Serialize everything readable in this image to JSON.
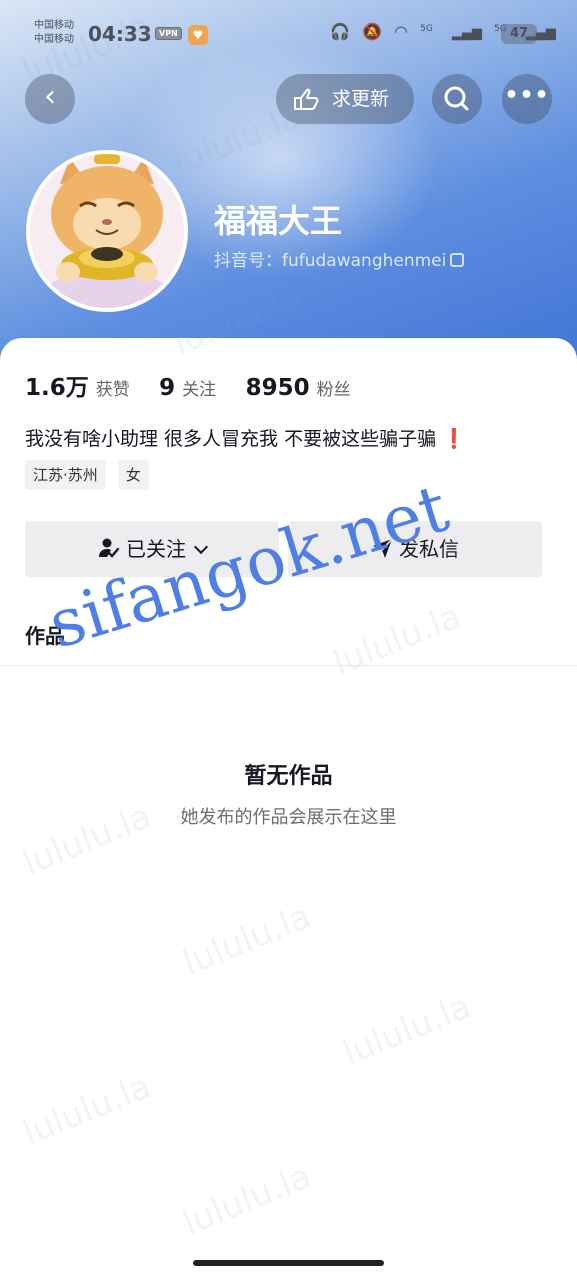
{
  "status_bar": {
    "carrier_1": "中国移动",
    "carrier_2": "中国移动",
    "time": "04:33",
    "vpn": "VPN",
    "signal_label_1": "5G",
    "signal_label_2": "5G",
    "battery": "47"
  },
  "nav": {
    "request_update_label": "求更新"
  },
  "profile": {
    "name": "福福大王",
    "douyin_id_label": "抖音号：",
    "douyin_id": "fufudawanghenmei",
    "likes_value": "1.6万",
    "likes_label": "获赞",
    "following_value": "9",
    "following_label": "关注",
    "followers_value": "8950",
    "followers_label": "粉丝",
    "bio": "我没有啥小助理 很多人冒充我 不要被这些骗子骗",
    "bio_emoji": "❗",
    "tags": [
      "江苏·苏州",
      "女"
    ]
  },
  "actions": {
    "followed_label": "已关注",
    "message_label": "发私信"
  },
  "tabs": {
    "works_label": "作品"
  },
  "empty_state": {
    "title": "暂无作品",
    "subtitle": "她发布的作品会展示在这里"
  },
  "watermarks": {
    "pattern_text": "lululu.la",
    "site_text": "sifangok.net"
  },
  "colors": {
    "header_gradient_start": "#dbe6f6",
    "header_gradient_end": "#3f73d6",
    "watermark_site": "#4d7fe6",
    "bio_exclaim": "#e83a3a"
  }
}
